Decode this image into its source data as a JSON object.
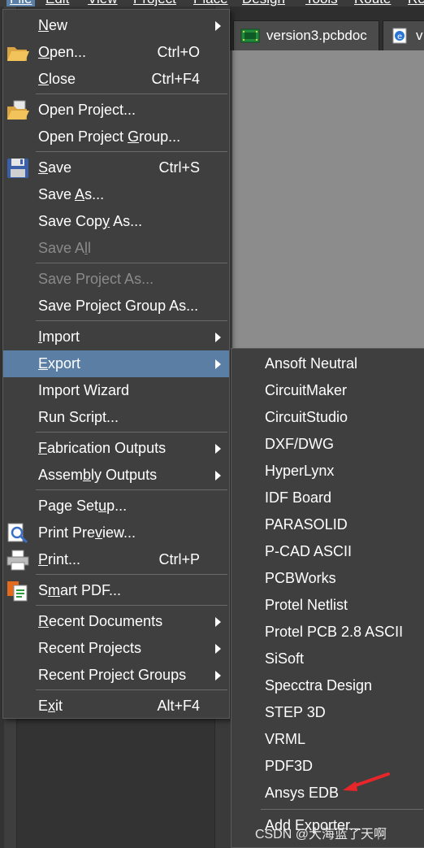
{
  "menubar": {
    "items": [
      "File",
      "Edit",
      "View",
      "Project",
      "Place",
      "Design",
      "Tools",
      "Route",
      "Re"
    ]
  },
  "doc_tabs": [
    {
      "label": "version3.pcbdoc",
      "icon": "pcb-document-icon"
    },
    {
      "label": "v",
      "icon": "web-document-icon"
    }
  ],
  "file_menu": {
    "items": [
      {
        "label": "New",
        "accel": "N",
        "shortcut": "",
        "submenu": true,
        "icon": ""
      },
      {
        "label": "Open...",
        "accel": "O",
        "shortcut": "Ctrl+O",
        "submenu": false,
        "icon": "open-folder-icon"
      },
      {
        "label": "Close",
        "accel": "C",
        "shortcut": "Ctrl+F4",
        "submenu": false,
        "icon": ""
      },
      {
        "label": "Open Project...",
        "accel": "j",
        "shortcut": "",
        "submenu": false,
        "icon": "open-project-icon"
      },
      {
        "label": "Open Project Group...",
        "accel": "G",
        "shortcut": "",
        "submenu": false,
        "icon": ""
      },
      {
        "label": "Save",
        "accel": "S",
        "shortcut": "Ctrl+S",
        "submenu": false,
        "icon": "floppy-disk-icon"
      },
      {
        "label": "Save As...",
        "accel": "A",
        "shortcut": "",
        "submenu": false,
        "icon": ""
      },
      {
        "label": "Save Copy As...",
        "accel": "y",
        "shortcut": "",
        "submenu": false,
        "icon": ""
      },
      {
        "label": "Save All",
        "accel": "l",
        "shortcut": "",
        "submenu": false,
        "icon": "",
        "disabled": true
      },
      {
        "label": "Save Project As...",
        "accel": "",
        "shortcut": "",
        "submenu": false,
        "icon": "",
        "disabled": true
      },
      {
        "label": "Save Project Group As...",
        "accel": "",
        "shortcut": "",
        "submenu": false,
        "icon": ""
      },
      {
        "label": "Import",
        "accel": "I",
        "shortcut": "",
        "submenu": true,
        "icon": ""
      },
      {
        "label": "Export",
        "accel": "E",
        "shortcut": "",
        "submenu": true,
        "icon": "",
        "highlighted": true
      },
      {
        "label": "Import Wizard",
        "accel": "",
        "shortcut": "",
        "submenu": false,
        "icon": ""
      },
      {
        "label": "Run Script...",
        "accel": "",
        "shortcut": "",
        "submenu": false,
        "icon": ""
      },
      {
        "label": "Fabrication Outputs",
        "accel": "F",
        "shortcut": "",
        "submenu": true,
        "icon": ""
      },
      {
        "label": "Assembly Outputs",
        "accel": "b",
        "shortcut": "",
        "submenu": true,
        "icon": ""
      },
      {
        "label": "Page Setup...",
        "accel": "u",
        "shortcut": "",
        "submenu": false,
        "icon": ""
      },
      {
        "label": "Print Preview...",
        "accel": "v",
        "shortcut": "",
        "submenu": false,
        "icon": "print-preview-icon"
      },
      {
        "label": "Print...",
        "accel": "P",
        "shortcut": "Ctrl+P",
        "submenu": false,
        "icon": "printer-icon"
      },
      {
        "label": "Smart PDF...",
        "accel": "m",
        "shortcut": "",
        "submenu": false,
        "icon": "smart-pdf-icon"
      },
      {
        "label": "Recent Documents",
        "accel": "R",
        "shortcut": "",
        "submenu": true,
        "icon": ""
      },
      {
        "label": "Recent Projects",
        "accel": "",
        "shortcut": "",
        "submenu": true,
        "icon": ""
      },
      {
        "label": "Recent Project Groups",
        "accel": "",
        "shortcut": "",
        "submenu": true,
        "icon": ""
      },
      {
        "label": "Exit",
        "accel": "x",
        "shortcut": "Alt+F4",
        "submenu": false,
        "icon": ""
      }
    ]
  },
  "export_submenu": {
    "items": [
      "Ansoft Neutral",
      "CircuitMaker",
      "CircuitStudio",
      "DXF/DWG",
      "HyperLynx",
      "IDF Board",
      "PARASOLID",
      "P-CAD ASCII",
      "PCBWorks",
      "Protel Netlist",
      "Protel PCB 2.8 ASCII",
      "SiSoft",
      "Specctra Design",
      "STEP 3D",
      "VRML",
      "PDF3D",
      "Ansys EDB",
      "Add Exporter..."
    ]
  },
  "annotation": {
    "arrow_color": "#e8262a",
    "watermark": "CSDN @大海蓝了天啊"
  },
  "colors": {
    "menu_bg": "#3f3f3f",
    "highlight": "#5b7ea5",
    "disabled_text": "#8a8a8a"
  }
}
